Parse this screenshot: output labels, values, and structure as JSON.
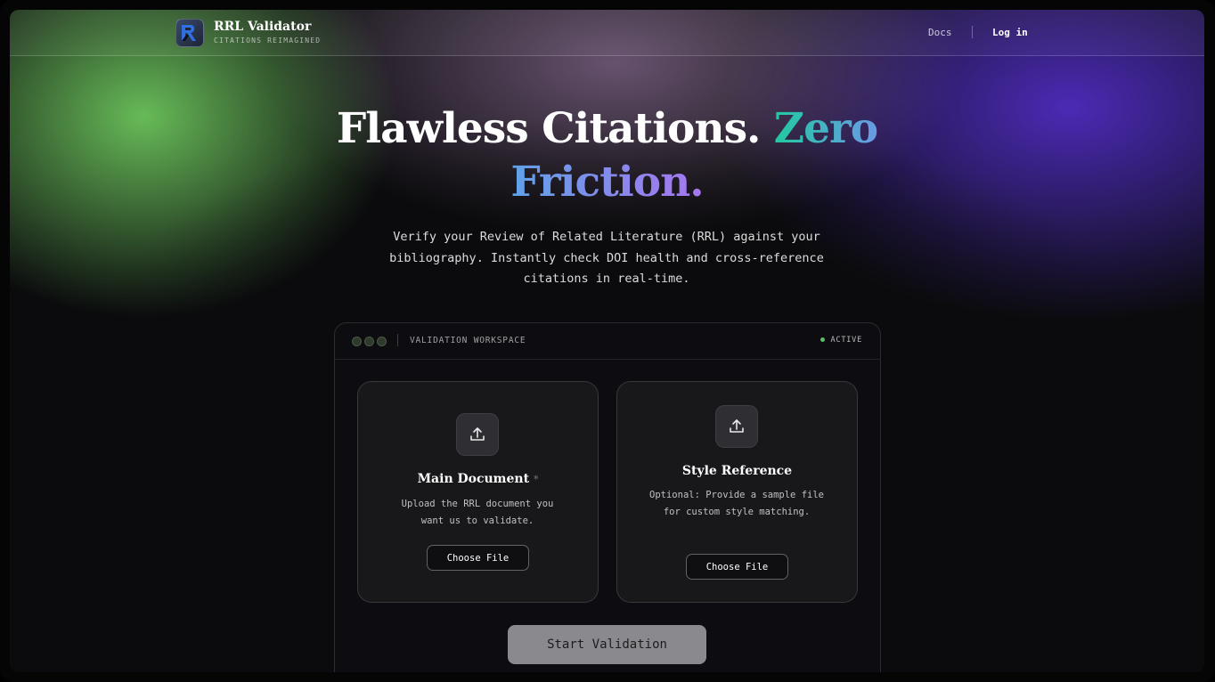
{
  "brand": {
    "name": "RRL Validator",
    "tagline": "CITATIONS REIMAGINED"
  },
  "nav": {
    "docs": "Docs",
    "login": "Log in"
  },
  "hero": {
    "title_plain": "Flawless Citations.",
    "title_accent_1": "Zero",
    "title_accent_2": "Friction.",
    "subtitle": "Verify your Review of Related Literature (RRL) against your bibliography. Instantly check DOI health and cross-reference citations in real-time."
  },
  "workspace": {
    "title": "VALIDATION WORKSPACE",
    "status": "ACTIVE",
    "cards": [
      {
        "title": "Main Document",
        "required_mark": "*",
        "description": "Upload the RRL document you want us to validate.",
        "button": "Choose File"
      },
      {
        "title": "Style Reference",
        "description": "Optional: Provide a sample file for custom style matching.",
        "button": "Choose File"
      }
    ],
    "start_button": "Start Validation"
  },
  "colors": {
    "accent_green": "#21c9a0",
    "accent_blue": "#6a9ae6",
    "accent_purple": "#a875f0",
    "status_green": "#5bbd6a"
  }
}
